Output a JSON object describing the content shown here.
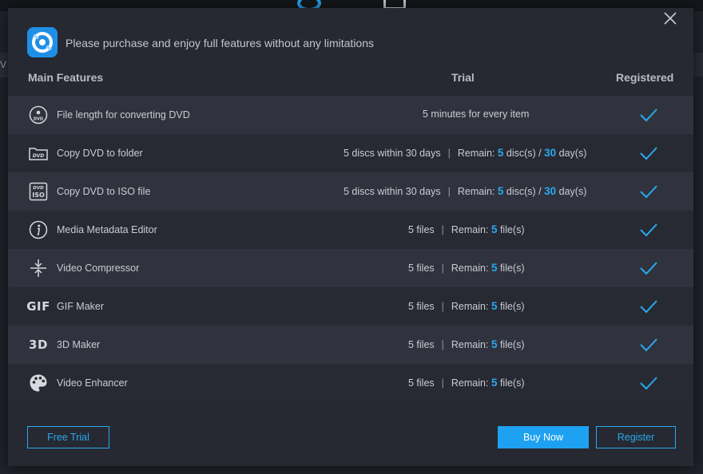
{
  "header": {
    "message": "Please purchase and enjoy full features without any limitations",
    "logo_icon": "app-logo-icon",
    "close_icon": "close-icon"
  },
  "columns": {
    "main": "Main Features",
    "trial": "Trial",
    "registered": "Registered"
  },
  "features": [
    {
      "icon": "dvd-disc-icon",
      "name": "File length for converting DVD",
      "trial": {
        "type": "plain",
        "text": "5 minutes for every item"
      }
    },
    {
      "icon": "dvd-folder-icon",
      "name": "Copy DVD to folder",
      "trial": {
        "type": "discs",
        "limit": "5 discs within 30 days",
        "remain_label": "Remain:",
        "remain_discs": "5",
        "discs_unit": "disc(s) /",
        "remain_days": "30",
        "days_unit": "day(s)"
      }
    },
    {
      "icon": "dvd-iso-icon",
      "name": "Copy DVD to ISO file",
      "trial": {
        "type": "discs",
        "limit": "5 discs within 30 days",
        "remain_label": "Remain:",
        "remain_discs": "5",
        "discs_unit": "disc(s) /",
        "remain_days": "30",
        "days_unit": "day(s)"
      }
    },
    {
      "icon": "info-icon",
      "name": "Media Metadata Editor",
      "trial": {
        "type": "files",
        "limit": "5 files",
        "remain_label": "Remain:",
        "remain_files": "5",
        "files_unit": "file(s)"
      }
    },
    {
      "icon": "compress-icon",
      "name": "Video Compressor",
      "trial": {
        "type": "files",
        "limit": "5 files",
        "remain_label": "Remain:",
        "remain_files": "5",
        "files_unit": "file(s)"
      }
    },
    {
      "icon": "gif-icon",
      "icon_text": "GIF",
      "name": "GIF Maker",
      "trial": {
        "type": "files",
        "limit": "5 files",
        "remain_label": "Remain:",
        "remain_files": "5",
        "files_unit": "file(s)"
      }
    },
    {
      "icon": "3d-icon",
      "icon_text": "3D",
      "name": "3D Maker",
      "trial": {
        "type": "files",
        "limit": "5 files",
        "remain_label": "Remain:",
        "remain_files": "5",
        "files_unit": "file(s)"
      }
    },
    {
      "icon": "palette-icon",
      "name": "Video Enhancer",
      "trial": {
        "type": "files",
        "limit": "5 files",
        "remain_label": "Remain:",
        "remain_files": "5",
        "files_unit": "file(s)"
      }
    }
  ],
  "registered_icon": "checkmark-icon",
  "buttons": {
    "free_trial": "Free Trial",
    "buy_now": "Buy Now",
    "register": "Register"
  },
  "background": {
    "left_text": "V"
  },
  "colors": {
    "accent": "#2aa8ee",
    "buy_button": "#1ea1f1",
    "dialog_bg": "#262932",
    "row_odd": "#30333d",
    "row_even": "#272a33"
  }
}
